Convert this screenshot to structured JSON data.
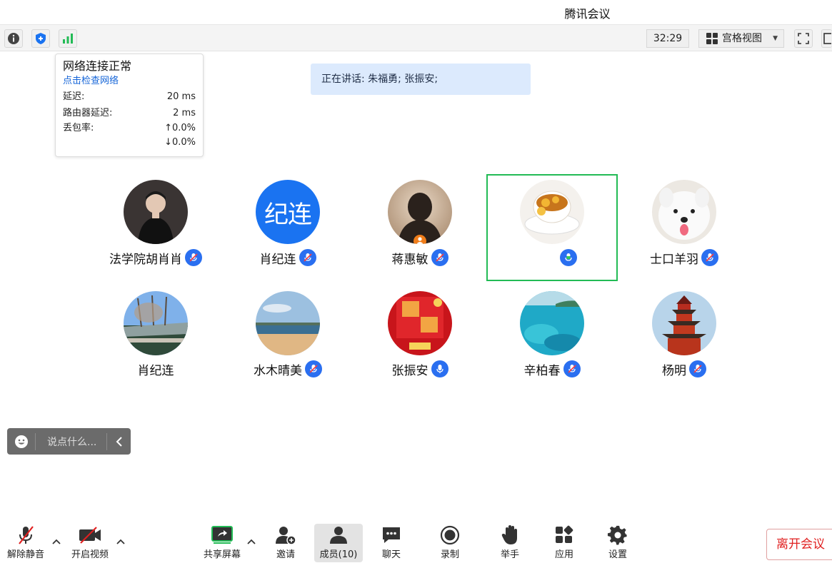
{
  "window": {
    "title": "腾讯会议"
  },
  "topbar": {
    "timer": "32:29",
    "view_mode": "宫格视图"
  },
  "network": {
    "title": "网络连接正常",
    "check_link": "点击检查网络",
    "latency_label": "延迟:",
    "latency_value": "20 ms",
    "router_label": "路由器延迟:",
    "router_value": "2 ms",
    "loss_label": "丢包率:",
    "loss_up": "↑0.0%",
    "loss_down": "↓0.0%"
  },
  "speaking": {
    "text": "正在讲话: 朱福勇; 张振安;"
  },
  "participants": [
    {
      "name": "法学院胡肖肖",
      "mic": "muted"
    },
    {
      "name": "肖纪连",
      "avatar_text": "纪连",
      "mic": "muted"
    },
    {
      "name": "蒋惠敏",
      "mic": "muted"
    },
    {
      "name": "",
      "mic": "speaking-green"
    },
    {
      "name": "士口羊羽",
      "mic": "muted"
    },
    {
      "name": "肖纪连",
      "mic": "none"
    },
    {
      "name": "水木晴美",
      "mic": "muted"
    },
    {
      "name": "张振安",
      "mic": "on"
    },
    {
      "name": "辛柏春",
      "mic": "muted"
    },
    {
      "name": "杨明",
      "mic": "muted"
    }
  ],
  "chat": {
    "placeholder": "说点什么..."
  },
  "bottombar": {
    "unmute": "解除静音",
    "start_video": "开启视频",
    "share_screen": "共享屏幕",
    "invite": "邀请",
    "members": "成员(10)",
    "chat": "聊天",
    "record": "录制",
    "raise_hand": "举手",
    "apps": "应用",
    "settings": "设置",
    "leave": "离开会议"
  },
  "colors": {
    "accent": "#1a73f1",
    "active_border": "#22bb55",
    "leave": "#e02020"
  }
}
